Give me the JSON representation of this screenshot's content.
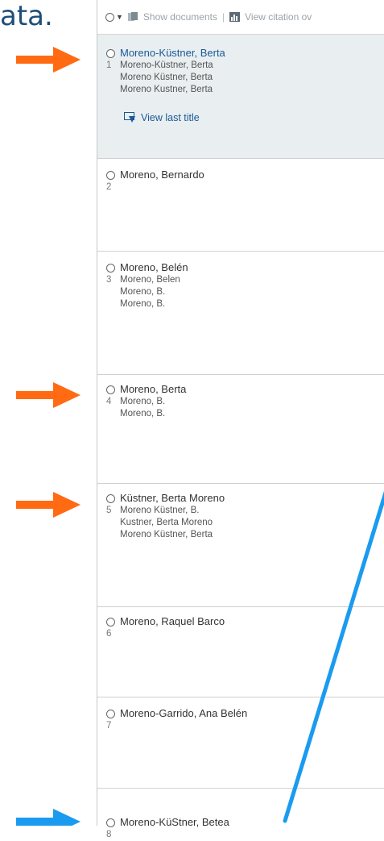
{
  "caption": "ata.",
  "toolbar": {
    "show_documents": "Show documents",
    "separator": "|",
    "view_citation": "View citation ov"
  },
  "authors": [
    {
      "number": "1",
      "name": "Moreno-Küstner, Berta",
      "variants": [
        "Moreno-Küstner, Berta",
        "Moreno Küstner, Berta",
        "Moreno Kustner, Berta"
      ],
      "selected": true,
      "action": "View last title"
    },
    {
      "number": "2",
      "name": "Moreno, Bernardo",
      "variants": []
    },
    {
      "number": "3",
      "name": "Moreno, Belén",
      "variants": [
        "Moreno, Belen",
        "Moreno, B.",
        "Moreno, B."
      ]
    },
    {
      "number": "4",
      "name": "Moreno, Berta",
      "variants": [
        "Moreno, B.",
        "Moreno, B."
      ]
    },
    {
      "number": "5",
      "name": "Küstner, Berta Moreno",
      "variants": [
        "Moreno Küstner, B.",
        "Kustner, Berta Moreno",
        "Moreno Küstner, Berta"
      ]
    },
    {
      "number": "6",
      "name": "Moreno, Raquel Barco",
      "variants": []
    },
    {
      "number": "7",
      "name": "Moreno-Garrido, Ana Belén",
      "variants": []
    },
    {
      "number": "8",
      "name": "Moreno-KüStner, Betea",
      "variants": []
    }
  ],
  "colors": {
    "orange_arrow": "#ff6a13",
    "blue_arrow": "#1a9bf0",
    "link": "#1a5a96"
  },
  "icons": {
    "show_documents": "documents-icon",
    "view_citation": "bar-chart-icon",
    "view_last_title": "download-arrow-icon"
  }
}
